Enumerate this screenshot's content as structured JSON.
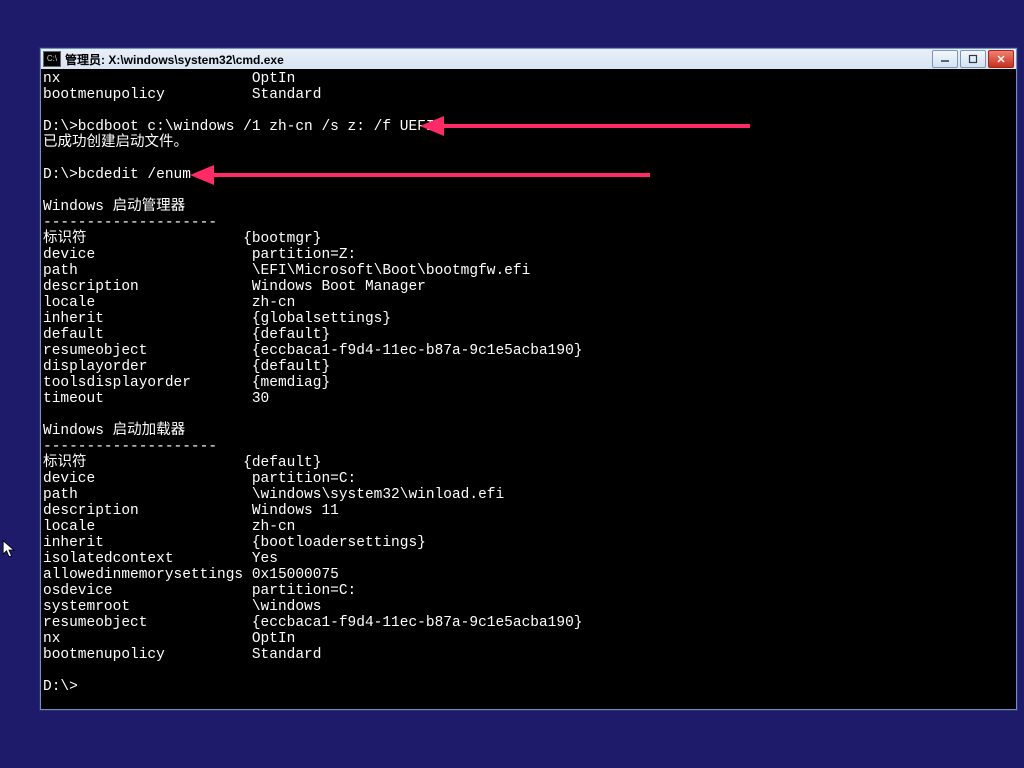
{
  "window": {
    "title": "管理员: X:\\windows\\system32\\cmd.exe",
    "icon_label": "cmd-icon"
  },
  "pre": {
    "line_nx_key": "nx",
    "line_nx_val": "OptIn",
    "line_bmp_key": "bootmenupolicy",
    "line_bmp_val": "Standard"
  },
  "prompt1": "D:\\>",
  "cmd1": "bcdboot c:\\windows /1 zh-cn /s z: /f UEFI",
  "result1": "已成功创建启动文件。",
  "prompt2": "D:\\>",
  "cmd2": "bcdedit /enum",
  "section1_title": "Windows 启动管理器",
  "section1_divider": "--------------------",
  "bootmgr": [
    {
      "key": "标识符",
      "val": "{bootmgr}"
    },
    {
      "key": "device",
      "val": "partition=Z:"
    },
    {
      "key": "path",
      "val": "\\EFI\\Microsoft\\Boot\\bootmgfw.efi"
    },
    {
      "key": "description",
      "val": "Windows Boot Manager"
    },
    {
      "key": "locale",
      "val": "zh-cn"
    },
    {
      "key": "inherit",
      "val": "{globalsettings}"
    },
    {
      "key": "default",
      "val": "{default}"
    },
    {
      "key": "resumeobject",
      "val": "{eccbaca1-f9d4-11ec-b87a-9c1e5acba190}"
    },
    {
      "key": "displayorder",
      "val": "{default}"
    },
    {
      "key": "toolsdisplayorder",
      "val": "{memdiag}"
    },
    {
      "key": "timeout",
      "val": "30"
    }
  ],
  "section2_title": "Windows 启动加载器",
  "section2_divider": "--------------------",
  "loader": [
    {
      "key": "标识符",
      "val": "{default}"
    },
    {
      "key": "device",
      "val": "partition=C:"
    },
    {
      "key": "path",
      "val": "\\windows\\system32\\winload.efi"
    },
    {
      "key": "description",
      "val": "Windows 11"
    },
    {
      "key": "locale",
      "val": "zh-cn"
    },
    {
      "key": "inherit",
      "val": "{bootloadersettings}"
    },
    {
      "key": "isolatedcontext",
      "val": "Yes"
    },
    {
      "key": "allowedinmemorysettings",
      "val": "0x15000075"
    },
    {
      "key": "osdevice",
      "val": "partition=C:"
    },
    {
      "key": "systemroot",
      "val": "\\windows"
    },
    {
      "key": "resumeobject",
      "val": "{eccbaca1-f9d4-11ec-b87a-9c1e5acba190}"
    },
    {
      "key": "nx",
      "val": "OptIn"
    },
    {
      "key": "bootmenupolicy",
      "val": "Standard"
    }
  ],
  "prompt3": "D:\\>",
  "annotation_arrow_label": "pointer-arrow"
}
